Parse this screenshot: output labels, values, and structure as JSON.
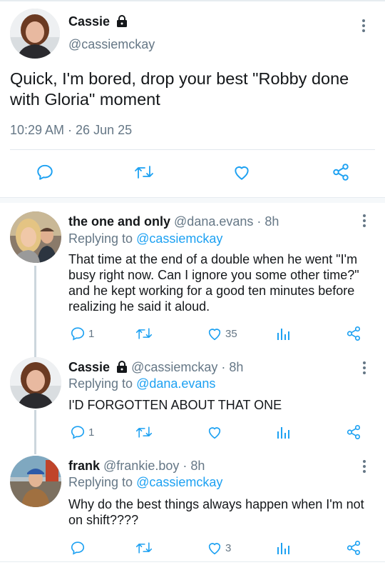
{
  "main": {
    "name": "Cassie",
    "handle": "@cassiemckay",
    "text": "Quick, I'm bored, drop your best \"Robby done with Gloria\" moment",
    "timestamp": "10:29 AM · 26 Jun 25",
    "icons": [
      "comment-icon",
      "retweet-icon",
      "like-icon",
      "share-icon"
    ]
  },
  "replies": [
    {
      "name": "the one and only",
      "handle": "@dana.evans",
      "time": " · 8h",
      "replying_prefix": "Replying to ",
      "replying_to": "@cassiemckay",
      "text": "That time at the end of a double when he went \"I'm busy right now. Can I ignore you some other time?\" and he kept working for a good ten minutes before realizing he said it aloud.",
      "reply_count": "1",
      "like_count": "35"
    },
    {
      "name": "Cassie",
      "handle": "@cassiemckay",
      "time": " · 8h",
      "replying_prefix": "Replying to ",
      "replying_to": "@dana.evans",
      "text": "I'D FORGOTTEN ABOUT THAT ONE",
      "reply_count": "1",
      "like_count": ""
    },
    {
      "name": "frank",
      "handle": "@frankie.boy",
      "time": " · 8h",
      "replying_prefix": "Replying to ",
      "replying_to": "@cassiemckay",
      "text": "Why do the best things always happen when I'm not on shift????",
      "reply_count": "",
      "like_count": "3"
    }
  ],
  "colors": {
    "link": "#1da1f2",
    "muted": "#657786",
    "text": "#14171a",
    "thread_line": "#ccd6dd"
  }
}
